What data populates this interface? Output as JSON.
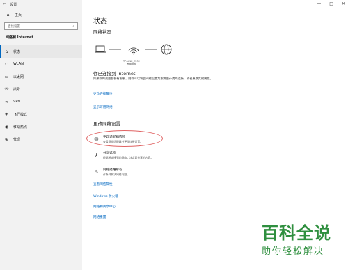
{
  "window": {
    "title": "设置",
    "back": "←",
    "min": "—",
    "max": "□",
    "close": "✕"
  },
  "sidebar": {
    "home": "主页",
    "search_placeholder": "查找设置",
    "section": "网络和 Internet",
    "items": [
      {
        "label": "状态",
        "icon": "globe-icon",
        "active": true
      },
      {
        "label": "WLAN",
        "icon": "wifi-icon"
      },
      {
        "label": "以太网",
        "icon": "ethernet-icon"
      },
      {
        "label": "拨号",
        "icon": "phone-icon"
      },
      {
        "label": "VPN",
        "icon": "vpn-icon"
      },
      {
        "label": "飞行模式",
        "icon": "airplane-icon"
      },
      {
        "label": "移动热点",
        "icon": "hotspot-icon"
      },
      {
        "label": "代理",
        "icon": "globe-icon"
      }
    ]
  },
  "main": {
    "title": "状态",
    "network_status": "网络状态",
    "router_name": "TP-LINK_E532",
    "router_type": "专用网络",
    "connected_title": "你已连接到 Internet",
    "connected_desc": "如果你的流量套餐有限制，则你可以将此网络设置为按流量计费的连接，或者更改其他属性。",
    "link_change_props": "更改连接属性",
    "link_show_networks": "显示可用网络",
    "change_settings_title": "更改网络设置",
    "options": [
      {
        "title": "更改适配器选项",
        "sub": "查看网络适配器并更改连接设置。",
        "icon": "adapter-icon"
      },
      {
        "title": "共享选项",
        "sub": "根据所连接到的网络，决定要共享的内容。",
        "icon": "share-icon"
      },
      {
        "title": "网络疑难解答",
        "sub": "诊断并解决网络问题。",
        "icon": "warning-icon"
      }
    ],
    "link_hw_props": "查看网络属性",
    "link_firewall": "Windows 防火墙",
    "link_sharing_center": "网络和共享中心",
    "link_reset": "网络重置"
  },
  "watermark": {
    "big": "百科全说",
    "small": "助你轻松解决"
  },
  "colors": {
    "accent": "#0067c0",
    "highlight": "#e06464",
    "watermark": "#2f8f3f"
  }
}
